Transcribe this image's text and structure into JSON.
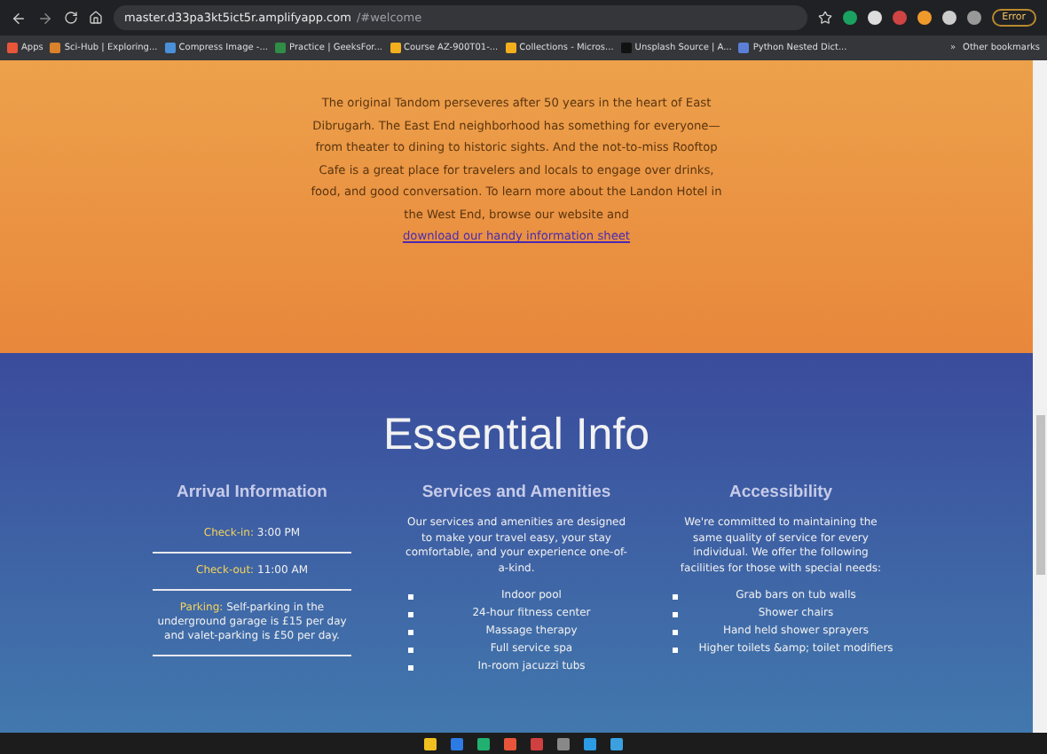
{
  "browser": {
    "url_host": "master.d33pa3kt5ict5r.amplifyapp.com",
    "url_path": "/#welcome",
    "profile_button": "Error",
    "bookmarks": [
      {
        "label": "Apps",
        "color": "#e8553a"
      },
      {
        "label": "Sci-Hub | Exploring...",
        "color": "#d9822b"
      },
      {
        "label": "Compress Image -...",
        "color": "#4a90d9"
      },
      {
        "label": "Practice | GeeksFor...",
        "color": "#2f8d46"
      },
      {
        "label": "Course AZ-900T01-...",
        "color": "#f2b01e"
      },
      {
        "label": "Collections - Micros...",
        "color": "#f2b01e"
      },
      {
        "label": "Unsplash Source | A...",
        "color": "#111111"
      },
      {
        "label": "Python Nested Dict...",
        "color": "#5b7fd6"
      }
    ],
    "more_bookmarks": "»",
    "other_bookmarks": "Other bookmarks"
  },
  "intro": {
    "text": "The original Tandom perseveres after 50 years in the heart of East Dibrugarh. The East End neighborhood has something for everyone—from theater to dining to historic sights. And the not-to-miss Rooftop Cafe is a great place for travelers and locals to engage over drinks, food, and good conversation.  To learn more about the Landon Hotel in the West End, browse our website and",
    "link": "download our handy information sheet"
  },
  "essential": {
    "title": "Essential Info",
    "arrival": {
      "heading": "Arrival Information",
      "items": [
        {
          "label": "Check-in:",
          "value": "3:00 PM"
        },
        {
          "label": "Check-out:",
          "value": "11:00 AM"
        },
        {
          "label": "Parking:",
          "value": "Self-parking in the underground garage is £15 per day and valet-parking is £50 per day."
        }
      ]
    },
    "services": {
      "heading": "Services and Amenities",
      "text": "Our services and amenities are designed to make your travel easy, your stay comfortable, and your experience one-of-a-kind.",
      "items": [
        "Indoor pool",
        "24-hour fitness center",
        "Massage therapy",
        "Full service spa",
        "In-room jacuzzi tubs"
      ]
    },
    "accessibility": {
      "heading": "Accessibility",
      "text": "We're committed to maintaining the same quality of service for every individual. We offer the following facilities for those with special needs:",
      "items": [
        "Grab bars on tub walls",
        "Shower chairs",
        "Hand held shower sprayers",
        "Higher toilets &amp; toilet modifiers"
      ]
    }
  }
}
